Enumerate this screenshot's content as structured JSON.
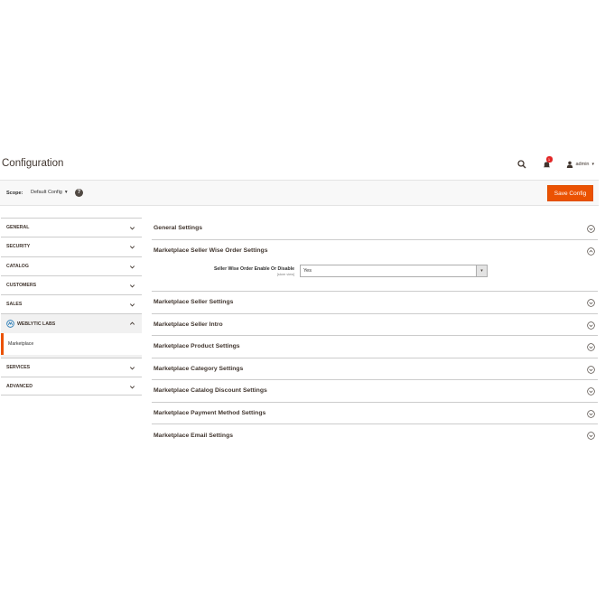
{
  "header": {
    "title": "Configuration",
    "notification_count": "1",
    "user_name": "admin",
    "icons": {
      "search": "search-icon",
      "notifications": "bell-icon",
      "user": "user-icon"
    }
  },
  "scope_bar": {
    "label": "Scope:",
    "value": "Default Config",
    "help": "?",
    "save_label": "Save Config"
  },
  "sidebar": {
    "items": [
      {
        "label": "GENERAL"
      },
      {
        "label": "SECURITY"
      },
      {
        "label": "CATALOG"
      },
      {
        "label": "CUSTOMERS"
      },
      {
        "label": "SALES"
      },
      {
        "label": "WEBLYTIC LABS",
        "expanded": true,
        "sub_items": [
          "Marketplace"
        ]
      },
      {
        "label": "SERVICES"
      },
      {
        "label": "ADVANCED"
      }
    ]
  },
  "sections": [
    {
      "title": "General Settings",
      "expanded": false
    },
    {
      "title": "Marketplace Seller Wise Order Settings",
      "expanded": true,
      "field": {
        "label": "Seller Wise Order Enable Or Disable",
        "scope": "[store view]",
        "value": "Yes"
      }
    },
    {
      "title": "Marketplace Seller Settings",
      "expanded": false
    },
    {
      "title": "Marketplace Seller Intro",
      "expanded": false
    },
    {
      "title": "Marketplace Product Settings",
      "expanded": false
    },
    {
      "title": "Marketplace Category Settings",
      "expanded": false
    },
    {
      "title": "Marketplace Catalog Discount Settings",
      "expanded": false
    },
    {
      "title": "Marketplace Payment Method Settings",
      "expanded": false
    },
    {
      "title": "Marketplace Email Settings",
      "expanded": false
    }
  ],
  "colors": {
    "accent": "#eb5202",
    "badge": "#e22626",
    "text": "#41362f"
  }
}
